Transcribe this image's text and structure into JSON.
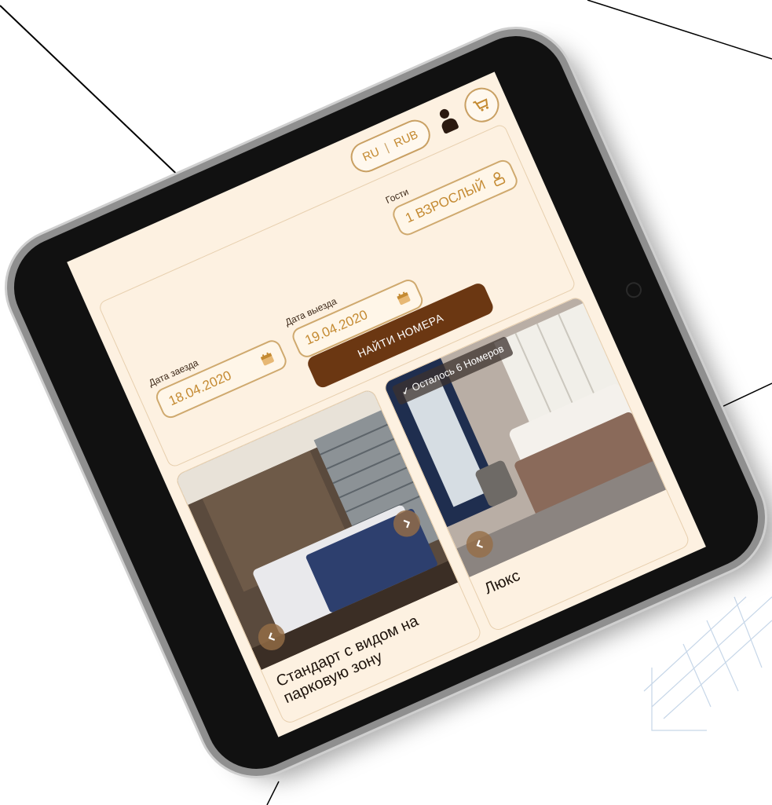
{
  "header": {
    "language": "RU",
    "currency": "RUB"
  },
  "search": {
    "arrival_label": "Дата заезда",
    "arrival_value": "18.04.2020",
    "departure_label": "Дата выезда",
    "departure_value": "19.04.2020",
    "guests_label": "Гости",
    "guests_value": "1 ВЗРОСЛЫЙ",
    "submit_label": "НАЙТИ НОМЕРА"
  },
  "rooms": [
    {
      "title": "Стандарт с видом на парковую зону",
      "badge": ""
    },
    {
      "title": "Люкс",
      "badge": "✓ Осталось 6 Номеров"
    }
  ],
  "colors": {
    "accent": "#c48a32",
    "button": "#6b3712",
    "screen_bg": "#fdf1e1"
  },
  "icons": [
    "calendar-icon",
    "person-icon",
    "user-icon",
    "cart-icon",
    "arrow-left-icon",
    "arrow-right-icon"
  ]
}
